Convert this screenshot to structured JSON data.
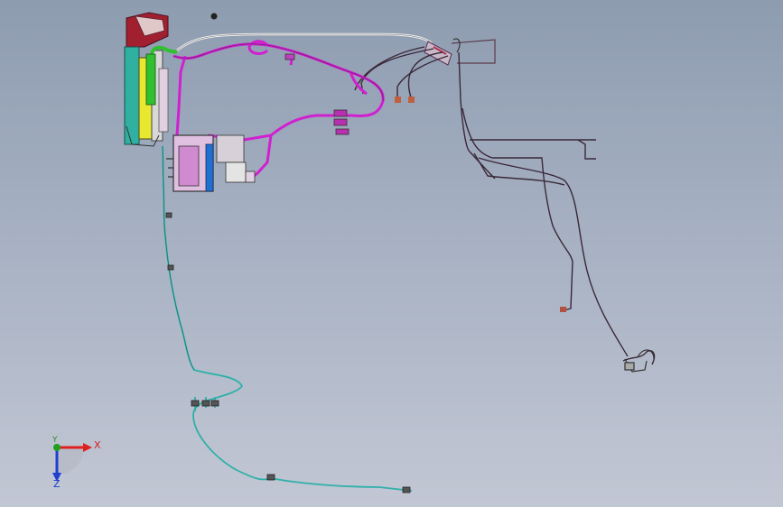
{
  "triad": {
    "x_label": "X",
    "y_label": "Y",
    "z_label": "Z",
    "colors": {
      "x": "#e02020",
      "y": "#20a020",
      "z": "#2040d0"
    }
  },
  "harness": {
    "colors": {
      "magenta": "#d020d0",
      "teal": "#2fb0a8",
      "dark": "#3a2a3a",
      "white": "#f4f4f4",
      "red": "#c02030",
      "green": "#30c030",
      "yellow": "#e8e020",
      "blue": "#2060d0"
    }
  }
}
